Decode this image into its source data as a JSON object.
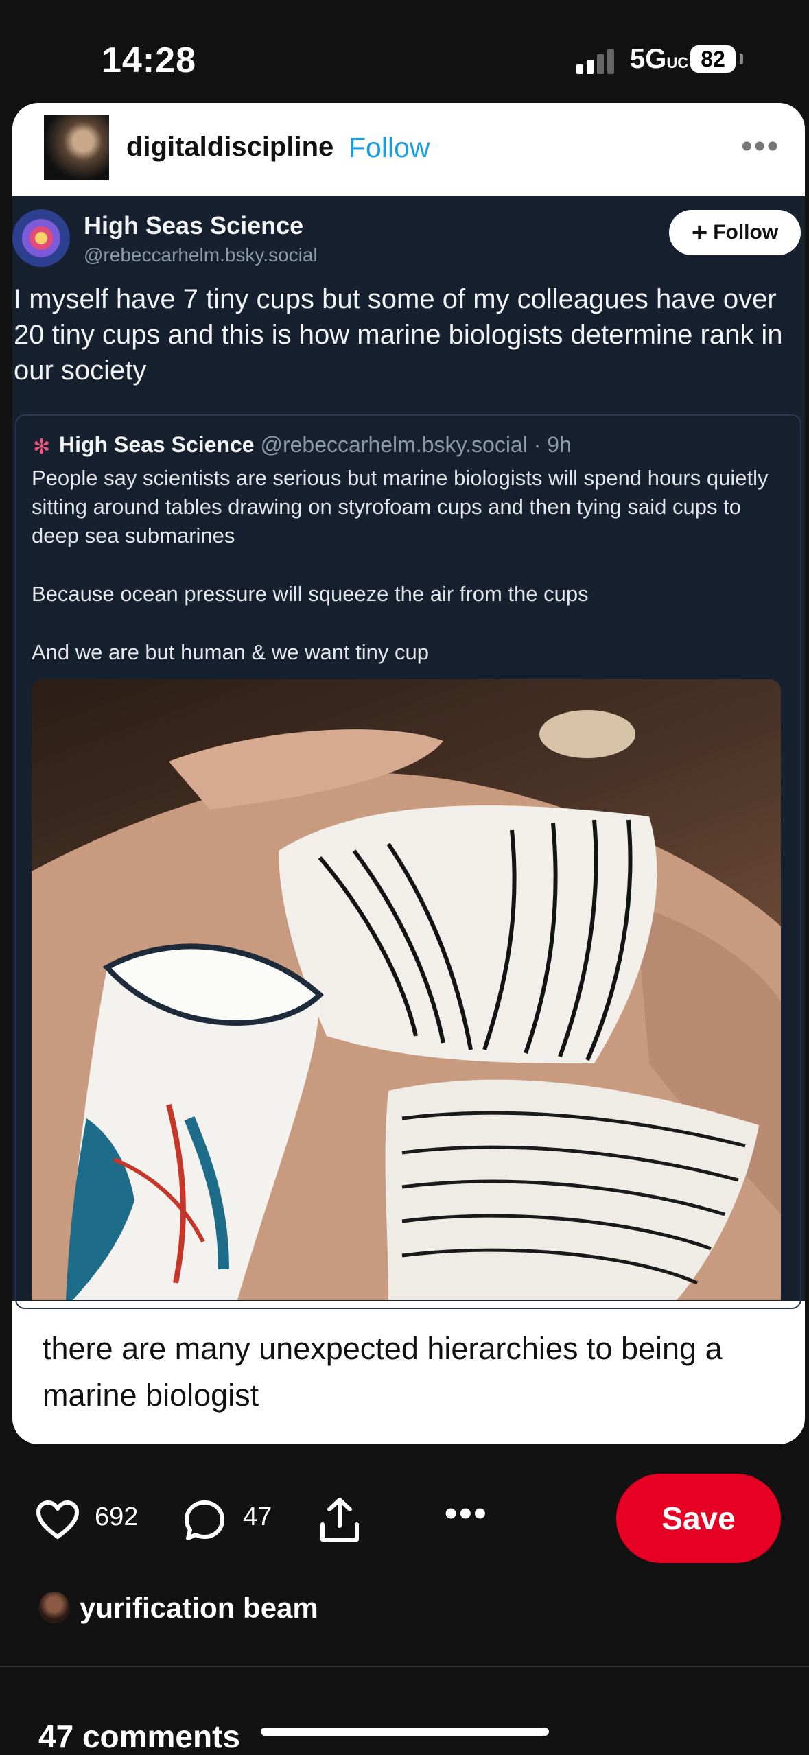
{
  "status_bar": {
    "time": "14:28",
    "network": "5G",
    "network_sup": "UC",
    "battery": "82"
  },
  "post": {
    "username": "digitaldiscipline",
    "follow_label": "Follow",
    "more_icon": "more-horizontal-icon",
    "caption": "there are many unexpected hierarchies to being a marine biologist"
  },
  "screenshot": {
    "author": "High Seas Science",
    "handle": "@rebeccarhelm.bsky.social",
    "follow_label": "Follow",
    "text": "I myself have 7 tiny cups but some of my colleagues have over 20 tiny cups and this is how marine biologists determine rank in our society",
    "quote": {
      "author": "High Seas Science",
      "handle_time": "@rebeccarhelm.bsky.social · 9h",
      "paragraphs": [
        "People say scientists are serious but marine biologists will spend hours quietly sitting around tables drawing on styrofoam cups and then tying said cups to deep sea submarines",
        "Because ocean pressure will squeeze the air from the cups",
        "And we are but human & we want tiny cup"
      ]
    }
  },
  "actions": {
    "likes": "692",
    "comments": "47",
    "save_label": "Save"
  },
  "board": {
    "name": "yurification beam"
  },
  "comments_section": {
    "title": "47 comments"
  },
  "colors": {
    "background": "#121212",
    "follow_blue": "#1a9de0",
    "save_red": "#e60023",
    "embed_bg": "#17202e"
  }
}
